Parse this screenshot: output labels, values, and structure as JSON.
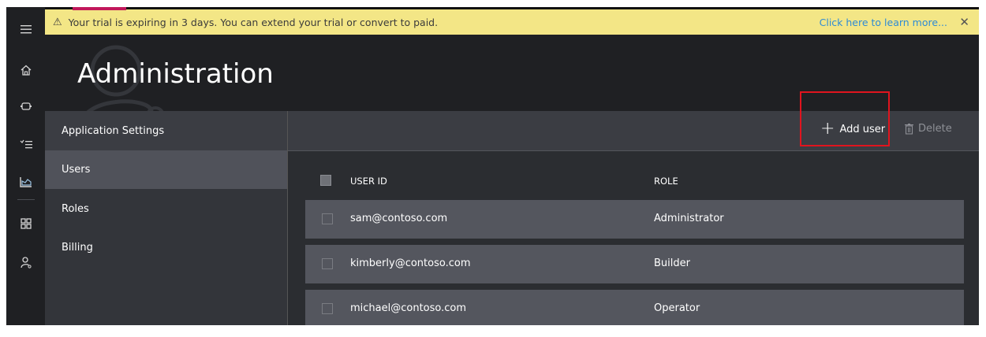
{
  "banner": {
    "message": "Your trial is expiring in 3 days. You can extend your trial or convert to paid.",
    "link": "Click here to learn more...",
    "close": "✕",
    "warn": "⚠"
  },
  "header": {
    "title": "Administration"
  },
  "nav": {
    "items": [
      {
        "label": "Application Settings"
      },
      {
        "label": "Users"
      },
      {
        "label": "Roles"
      },
      {
        "label": "Billing"
      }
    ]
  },
  "toolbar": {
    "add_label": "Add user",
    "add_icon": "+",
    "delete_label": "Delete"
  },
  "table": {
    "columns": [
      "USER ID",
      "ROLE"
    ],
    "rows": [
      {
        "user_id": "sam@contoso.com",
        "role": "Administrator"
      },
      {
        "user_id": "kimberly@contoso.com",
        "role": "Builder"
      },
      {
        "user_id": "michael@contoso.com",
        "role": "Operator"
      }
    ]
  },
  "icons": [
    "menu-icon",
    "home-icon",
    "device-icon",
    "rules-icon",
    "analytics-icon",
    "dashboard-icon",
    "admin-icon"
  ],
  "colors": {
    "banner_bg": "#f3e686",
    "link": "#2e8bd6",
    "highlight": "#e0141e"
  }
}
